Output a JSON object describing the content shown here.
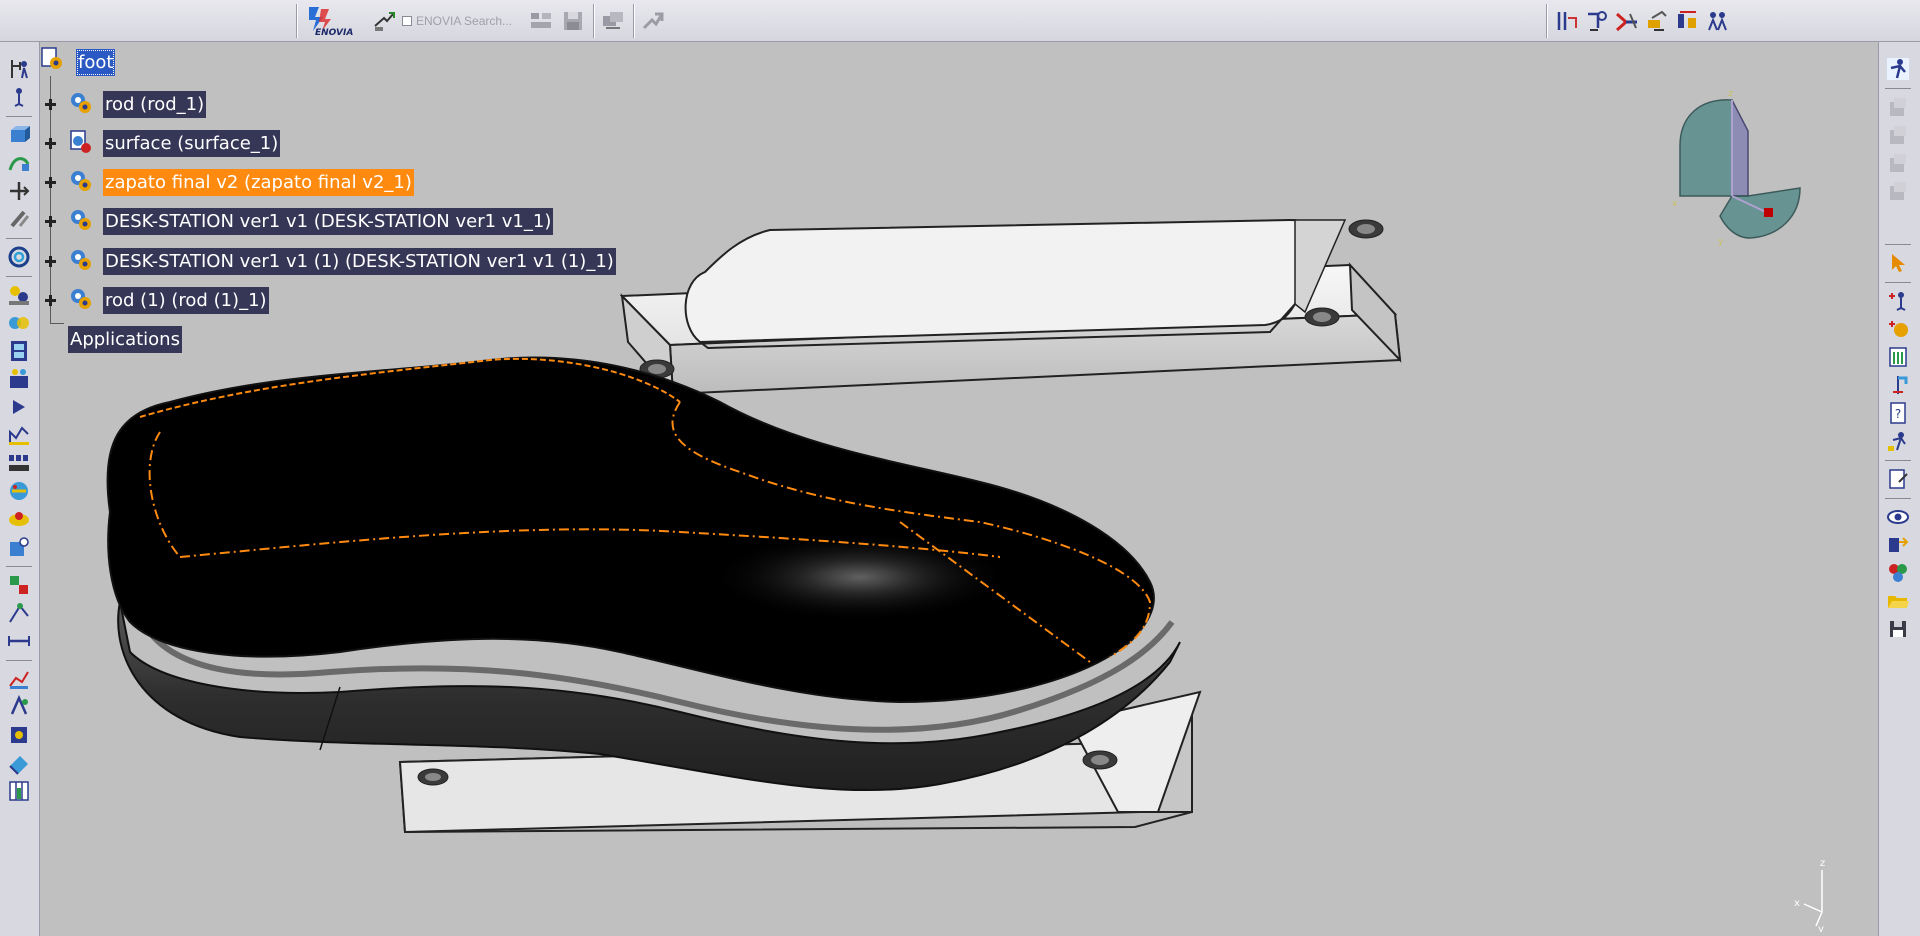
{
  "toolbar_top": {
    "brand_label": "ENOVIA",
    "search_placeholder": "ENOVIA Search..."
  },
  "tree": {
    "root": "foot",
    "items": [
      {
        "label": "rod (rod_1)",
        "state": "selected"
      },
      {
        "label": "surface (surface_1)",
        "state": "selected"
      },
      {
        "label": "zapato final v2 (zapato final v2_1)",
        "state": "active"
      },
      {
        "label": "DESK-STATION ver1 v1 (DESK-STATION ver1 v1_1)",
        "state": "selected"
      },
      {
        "label": "DESK-STATION ver1 v1 (1) (DESK-STATION ver1 v1 (1)_1)",
        "state": "selected"
      },
      {
        "label": "rod (1) (rod (1)_1)",
        "state": "selected"
      }
    ],
    "applications": "Applications"
  },
  "compass_axes": {
    "x": "x",
    "y": "y",
    "z": "z"
  },
  "mini_axes": {
    "x": "x",
    "y": "y",
    "z": "z"
  },
  "colors": {
    "background": "#c0c0c0",
    "selection": "#363657",
    "active": "#ff8a10",
    "root_highlight": "#2b59c3",
    "shoe": "#000000",
    "sole": "#3a3a3a",
    "plate": "#f2f2f2"
  }
}
